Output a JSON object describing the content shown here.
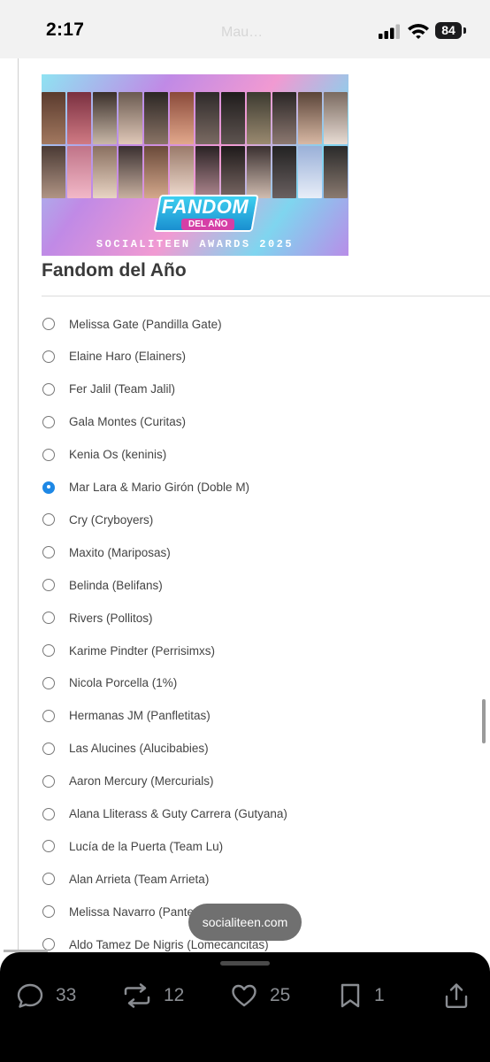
{
  "status_bar": {
    "time": "2:17",
    "faded_text": "Mau…",
    "battery": "84"
  },
  "banner": {
    "badge_title": "FANDOM",
    "badge_subtitle": "DEL AÑO",
    "caption": "SOCIALITEEN AWARDS 2025"
  },
  "poll": {
    "title": "Fandom del Año",
    "selected_index": 5,
    "options": [
      "Melissa Gate (Pandilla Gate)",
      "Elaine Haro (Elainers)",
      "Fer Jalil (Team Jalil)",
      "Gala Montes (Curitas)",
      "Kenia Os (keninis)",
      "Mar Lara & Mario Girón (Doble M)",
      "Cry (Cryboyers)",
      "Maxito (Mariposas)",
      "Belinda (Belifans)",
      "Rivers (Pollitos)",
      "Karime Pindter (Perrisimxs)",
      "Nicola Porcella (1%)",
      "Hermanas JM (Panfletitas)",
      "Las Alucines (Alucibabies)",
      "Aaron Mercury (Mercurials)",
      "Alana Lliterass & Guty Carrera (Gutyana)",
      "Lucía de la Puerta (Team Lu)",
      "Alan Arrieta (Team Arrieta)",
      "Melissa Navarro (Pante…",
      "Aldo Tamez De Nigris (Lomecancitas)"
    ]
  },
  "toast": {
    "text": "socialiteen.com"
  },
  "actions": {
    "reply_count": "33",
    "repost_count": "12",
    "like_count": "25",
    "bookmark_count": "1",
    "icons": [
      "reply-icon",
      "repost-icon",
      "heart-icon",
      "bookmark-icon",
      "share-icon"
    ]
  },
  "colors": {
    "accent": "#1e88e5",
    "bottom_bar": "#000000",
    "count_text": "#8a8d92"
  }
}
